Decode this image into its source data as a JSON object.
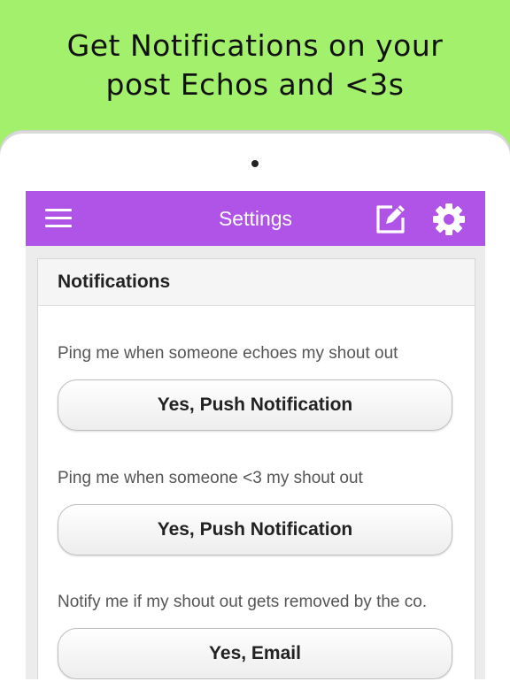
{
  "promo": {
    "line1": "Get Notifications on your",
    "line2": "post Echos and <3s"
  },
  "appbar": {
    "title": "Settings",
    "color": "#b054e8",
    "icons": [
      "menu-icon",
      "edit-icon",
      "gear-icon"
    ]
  },
  "panel": {
    "header": "Notifications",
    "settings": [
      {
        "label": "Ping me when someone echoes my shout out",
        "value": "Yes, Push Notification"
      },
      {
        "label": "Ping me when someone <3 my shout out",
        "value": "Yes, Push Notification"
      },
      {
        "label": "Notify me if my shout out gets removed by the co.",
        "value": "Yes, Email"
      }
    ]
  },
  "colors": {
    "background": "#a2f06b",
    "accent": "#b054e8"
  }
}
